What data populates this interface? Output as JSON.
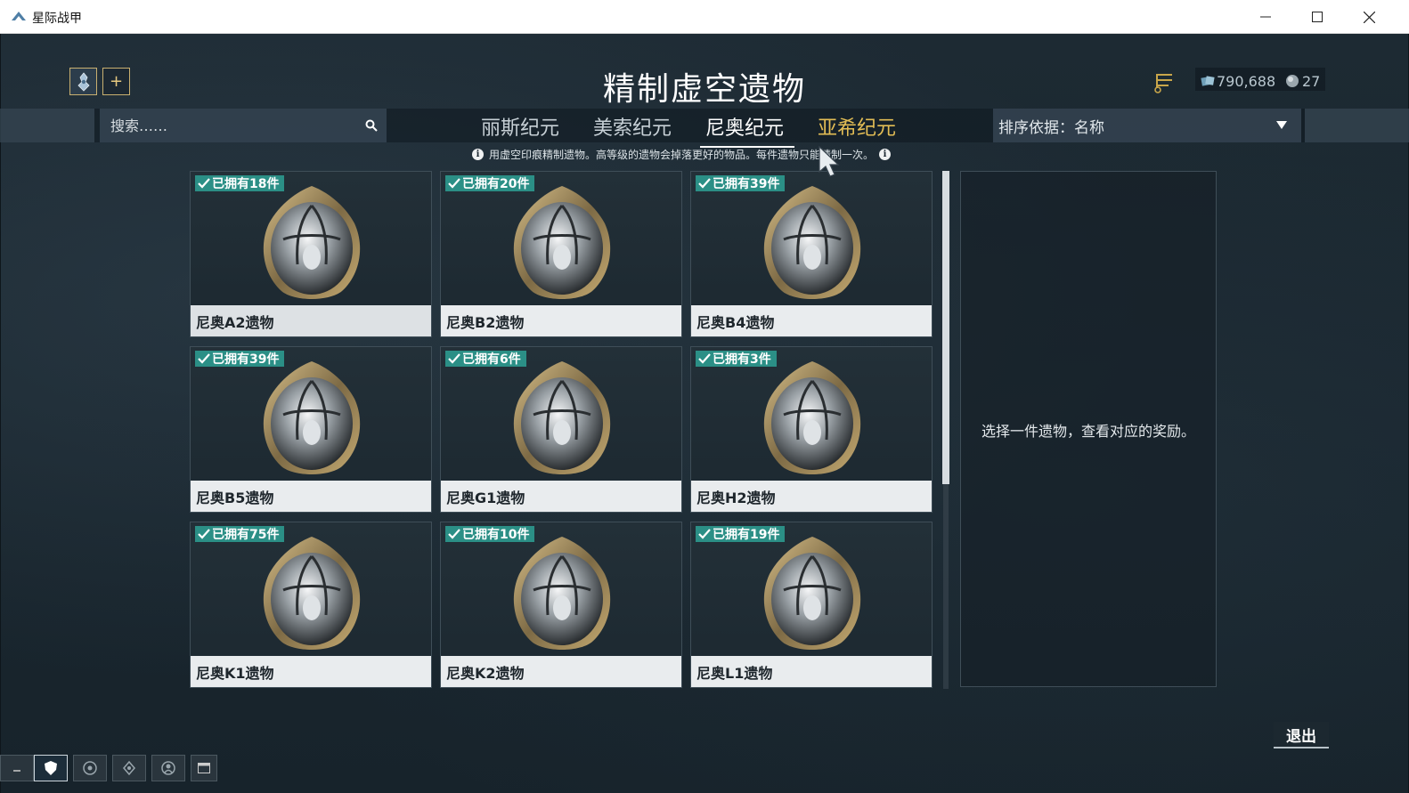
{
  "window": {
    "title": "星际战甲",
    "app_icon": "warframe-app-icon",
    "controls": [
      "minimize-icon",
      "maximize-icon",
      "close-icon"
    ]
  },
  "header": {
    "page_title": "精制虚空遗物",
    "profile_icon": "profile-avatar-icon",
    "add_label": "+",
    "currencies": {
      "credits": "790,688",
      "platinum": "27"
    }
  },
  "search": {
    "placeholder": "搜索……"
  },
  "tabs": [
    {
      "label": "丽斯纪元",
      "state": "normal"
    },
    {
      "label": "美索纪元",
      "state": "normal"
    },
    {
      "label": "尼奥纪元",
      "state": "active"
    },
    {
      "label": "亚希纪元",
      "state": "highlighted"
    }
  ],
  "sort": {
    "label": "排序依据：名称"
  },
  "info": {
    "text": "用虚空印痕精制遗物。高等级的遗物会掉落更好的物品。每件遗物只能精制一次。"
  },
  "relics": [
    {
      "owned": "已拥有18件",
      "name": "尼奥A2遗物"
    },
    {
      "owned": "已拥有20件",
      "name": "尼奥B2遗物"
    },
    {
      "owned": "已拥有39件",
      "name": "尼奥B4遗物"
    },
    {
      "owned": "已拥有39件",
      "name": "尼奥B5遗物"
    },
    {
      "owned": "已拥有6件",
      "name": "尼奥G1遗物"
    },
    {
      "owned": "已拥有3件",
      "name": "尼奥H2遗物"
    },
    {
      "owned": "已拥有75件",
      "name": "尼奥K1遗物"
    },
    {
      "owned": "已拥有10件",
      "name": "尼奥K2遗物"
    },
    {
      "owned": "已拥有19件",
      "name": "尼奥L1遗物"
    }
  ],
  "reward_panel": {
    "hint": "选择一件遗物，查看对应的奖励。"
  },
  "exit": {
    "label": "退出"
  },
  "colors": {
    "badge": "#2b8f86",
    "gold_tab": "#e3bd55",
    "accent_border": "#c9b070"
  }
}
